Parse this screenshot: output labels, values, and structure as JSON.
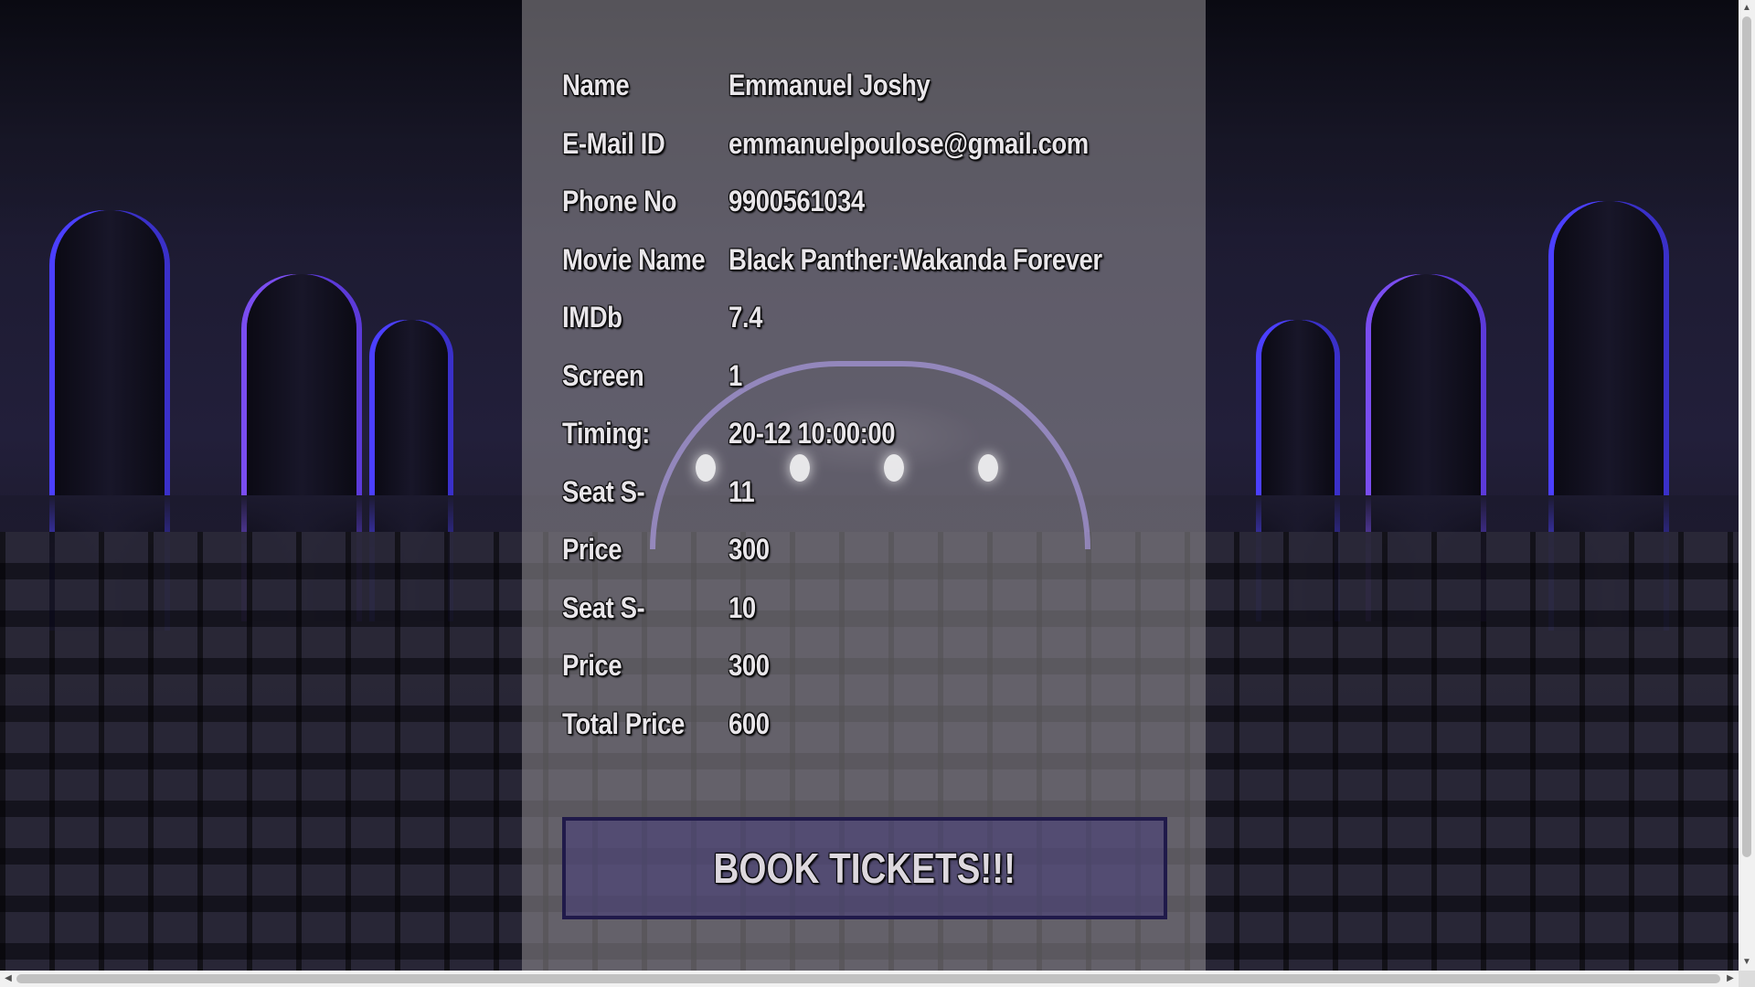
{
  "details": [
    {
      "label": "Name",
      "value": "Emmanuel Joshy"
    },
    {
      "label": "E-Mail ID",
      "value": "emmanuelpoulose@gmail.com"
    },
    {
      "label": "Phone No",
      "value": "9900561034"
    },
    {
      "label": "Movie Name",
      "value": "Black Panther:Wakanda Forever"
    },
    {
      "label": "IMDb",
      "value": "7.4"
    },
    {
      "label": "Screen",
      "value": "1"
    },
    {
      "label": "Timing:",
      "value": "20-12 10:00:00"
    },
    {
      "label": "Seat S-",
      "value": "11"
    },
    {
      "label": "Price",
      "value": "300"
    },
    {
      "label": "Seat S-",
      "value": "10"
    },
    {
      "label": "Price",
      "value": "300"
    },
    {
      "label": "Total Price",
      "value": "600"
    }
  ],
  "book_button": {
    "label": "BOOK TICKETS!!!"
  },
  "scrollbars": {
    "up_arrow": "▲",
    "down_arrow": "▼",
    "left_arrow": "◀",
    "right_arrow": "▶"
  },
  "colors": {
    "panel": "#969296",
    "button_border": "#201a4a",
    "text": "#e9e6ea"
  }
}
